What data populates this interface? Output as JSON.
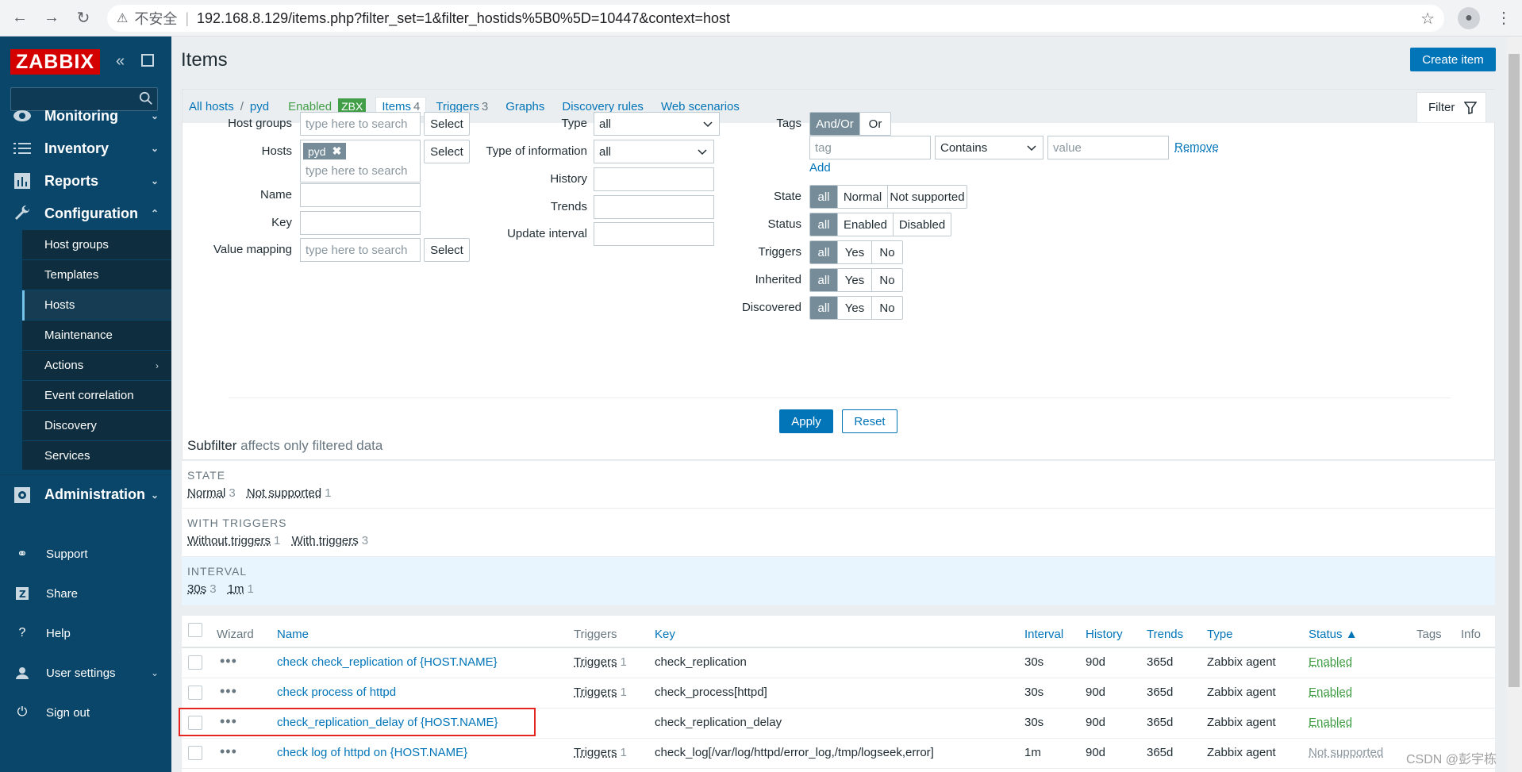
{
  "browser": {
    "insecure_label": "不安全",
    "url": "192.168.8.129/items.php?filter_set=1&filter_hostids%5B0%5D=10447&context=host"
  },
  "sidebar": {
    "logo": "ZABBIX",
    "search_placeholder": "",
    "menu": [
      {
        "label": "Monitoring",
        "icon": "eye-icon"
      },
      {
        "label": "Inventory",
        "icon": "list-icon"
      },
      {
        "label": "Reports",
        "icon": "chart-icon"
      },
      {
        "label": "Configuration",
        "icon": "wrench-icon"
      },
      {
        "label": "Administration",
        "icon": "gear-icon"
      }
    ],
    "config_sub": [
      "Host groups",
      "Templates",
      "Hosts",
      "Maintenance",
      "Actions",
      "Event correlation",
      "Discovery",
      "Services"
    ],
    "bottom": [
      {
        "label": "Support",
        "icon": "headset-icon"
      },
      {
        "label": "Share",
        "icon": "share-icon"
      },
      {
        "label": "Help",
        "icon": "help-icon"
      },
      {
        "label": "User settings",
        "icon": "user-icon"
      },
      {
        "label": "Sign out",
        "icon": "power-icon"
      }
    ]
  },
  "header": {
    "title": "Items",
    "create_button": "Create item"
  },
  "nav": {
    "all_hosts": "All hosts",
    "separator": "/",
    "host": "pyd",
    "enabled": "Enabled",
    "zbx": "ZBX",
    "items": "Items",
    "items_count": "4",
    "triggers": "Triggers",
    "triggers_count": "3",
    "graphs": "Graphs",
    "discovery": "Discovery rules",
    "web": "Web scenarios",
    "filter": "Filter"
  },
  "filter": {
    "host_groups_label": "Host groups",
    "hosts_label": "Hosts",
    "name_label": "Name",
    "key_label": "Key",
    "value_mapping_label": "Value mapping",
    "search_placeholder": "type here to search",
    "select": "Select",
    "host_chip": "pyd",
    "type_label": "Type",
    "type_value": "all",
    "type_info_label": "Type of information",
    "type_info_value": "all",
    "history_label": "History",
    "trends_label": "Trends",
    "update_interval_label": "Update interval",
    "tags_label": "Tags",
    "andor": "And/Or",
    "or": "Or",
    "tag_placeholder": "tag",
    "contains": "Contains",
    "value_placeholder": "value",
    "remove": "Remove",
    "add": "Add",
    "state_label": "State",
    "status_label": "Status",
    "triggers_label": "Triggers",
    "inherited_label": "Inherited",
    "discovered_label": "Discovered",
    "all": "all",
    "normal": "Normal",
    "not_supported": "Not supported",
    "enabled": "Enabled",
    "disabled": "Disabled",
    "yes": "Yes",
    "no": "No",
    "apply": "Apply",
    "reset": "Reset"
  },
  "subfilter": {
    "title": "Subfilter",
    "subtitle": "affects only filtered data",
    "state_head": "STATE",
    "state_vals": [
      {
        "label": "Normal",
        "count": "3"
      },
      {
        "label": "Not supported",
        "count": "1"
      }
    ],
    "triggers_head": "WITH TRIGGERS",
    "triggers_vals": [
      {
        "label": "Without triggers",
        "count": "1"
      },
      {
        "label": "With triggers",
        "count": "3"
      }
    ],
    "interval_head": "INTERVAL",
    "interval_vals": [
      {
        "label": "30s",
        "count": "3"
      },
      {
        "label": "1m",
        "count": "1"
      }
    ]
  },
  "table": {
    "headers": {
      "wizard": "Wizard",
      "name": "Name",
      "triggers": "Triggers",
      "key": "Key",
      "interval": "Interval",
      "history": "History",
      "trends": "Trends",
      "type": "Type",
      "status": "Status ▲",
      "tags": "Tags",
      "info": "Info"
    },
    "rows": [
      {
        "name": "check check_replication of {HOST.NAME}",
        "triggers": "Triggers",
        "tcount": "1",
        "key": "check_replication",
        "interval": "30s",
        "history": "90d",
        "trends": "365d",
        "type": "Zabbix agent",
        "status": "Enabled"
      },
      {
        "name": "check process of httpd",
        "triggers": "Triggers",
        "tcount": "1",
        "key": "check_process[httpd]",
        "interval": "30s",
        "history": "90d",
        "trends": "365d",
        "type": "Zabbix agent",
        "status": "Enabled"
      },
      {
        "name": "check_replication_delay of {HOST.NAME}",
        "triggers": "",
        "tcount": "",
        "key": "check_replication_delay",
        "interval": "30s",
        "history": "90d",
        "trends": "365d",
        "type": "Zabbix agent",
        "status": "Enabled"
      },
      {
        "name": "check log of httpd on {HOST.NAME}",
        "triggers": "Triggers",
        "tcount": "1",
        "key": "check_log[/var/log/httpd/error_log,/tmp/logseek,error]",
        "interval": "1m",
        "history": "90d",
        "trends": "365d",
        "type": "Zabbix agent",
        "status": "Not supported"
      }
    ]
  },
  "watermark": "CSDN @彭宇栋"
}
